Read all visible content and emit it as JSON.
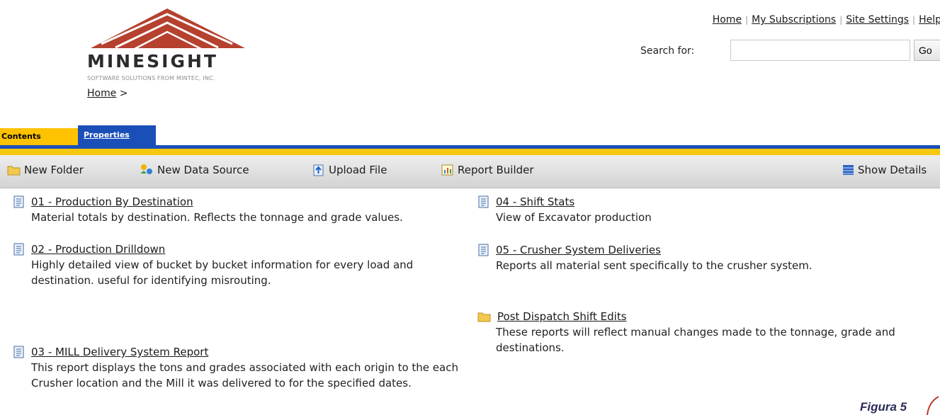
{
  "header": {
    "logo_text": "MINESIGHT",
    "logo_subtitle": "SOFTWARE SOLUTIONS FROM MINTEC, INC.",
    "breadcrumb": "Home",
    "breadcrumb_sep": ">",
    "links": [
      "Home",
      "My Subscriptions",
      "Site Settings",
      "Help"
    ],
    "search_label": "Search for:",
    "search_value": "",
    "go_label": "Go"
  },
  "tabs": [
    "Contents",
    "Properties"
  ],
  "toolbar": {
    "new_folder": "New Folder",
    "new_data_source": "New Data Source",
    "upload_file": "Upload File",
    "report_builder": "Report Builder",
    "show_details": "Show Details"
  },
  "reports": [
    {
      "title": "01 - Production By Destination",
      "desc": "Material totals by destination. Reflects the tonnage and grade values."
    },
    {
      "title": "02 - Production Drilldown",
      "desc": "Highly detailed view of bucket by bucket information for every load and destination. useful for identifying misrouting."
    },
    {
      "title": "03 - MILL Delivery System Report",
      "desc": "This report displays the tons and grades associated with each origin to the each Crusher location and the Mill it was delivered to for the specified dates."
    },
    {
      "title": "04 - Shift Stats",
      "desc": "View of Excavator production"
    },
    {
      "title": "05 - Crusher System Deliveries",
      "desc": "Reports all material sent specifically to the crusher system."
    },
    {
      "title": "Post Dispatch Shift Edits",
      "desc": "These reports will reflect manual changes made to the tonnage, grade and destinations."
    }
  ],
  "figure_caption": "Figura 5",
  "colors": {
    "tab_active": "#ffc200",
    "tab_inactive": "#1b4fb8",
    "gold_bar": "#f6c90f",
    "logo_red": "#b5412e"
  }
}
